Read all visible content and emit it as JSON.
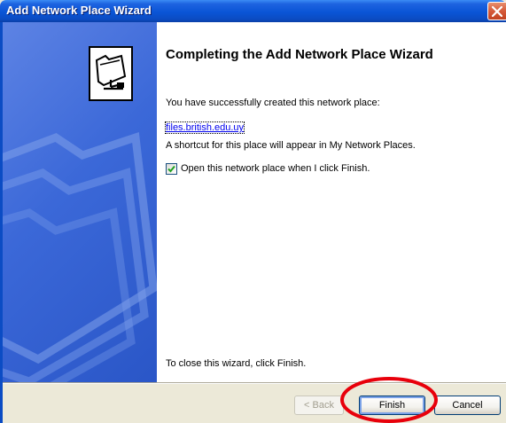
{
  "window": {
    "title": "Add Network Place Wizard",
    "close_icon": "close-icon"
  },
  "sidebar": {
    "icon": "network-folder-icon"
  },
  "content": {
    "heading": "Completing the Add Network Place Wizard",
    "success_text": "You have successfully created this network place:",
    "place_link": "files.british.edu.uy",
    "shortcut_text": "A shortcut for this place will appear in My Network Places.",
    "open_checkbox": {
      "label": "Open this network place when I click Finish.",
      "checked": true
    },
    "close_hint": "To close this wizard, click Finish."
  },
  "buttons": {
    "back": {
      "label": "< Back",
      "enabled": false
    },
    "finish": {
      "label": "Finish",
      "enabled": true,
      "focused": true
    },
    "cancel": {
      "label": "Cancel",
      "enabled": true
    }
  },
  "annotation": {
    "ring_color": "#e8000b"
  },
  "colors": {
    "titlebar": "#0a55d6",
    "sidebar": "#3b68d8",
    "face": "#ece9d8",
    "link": "#0000ee"
  }
}
